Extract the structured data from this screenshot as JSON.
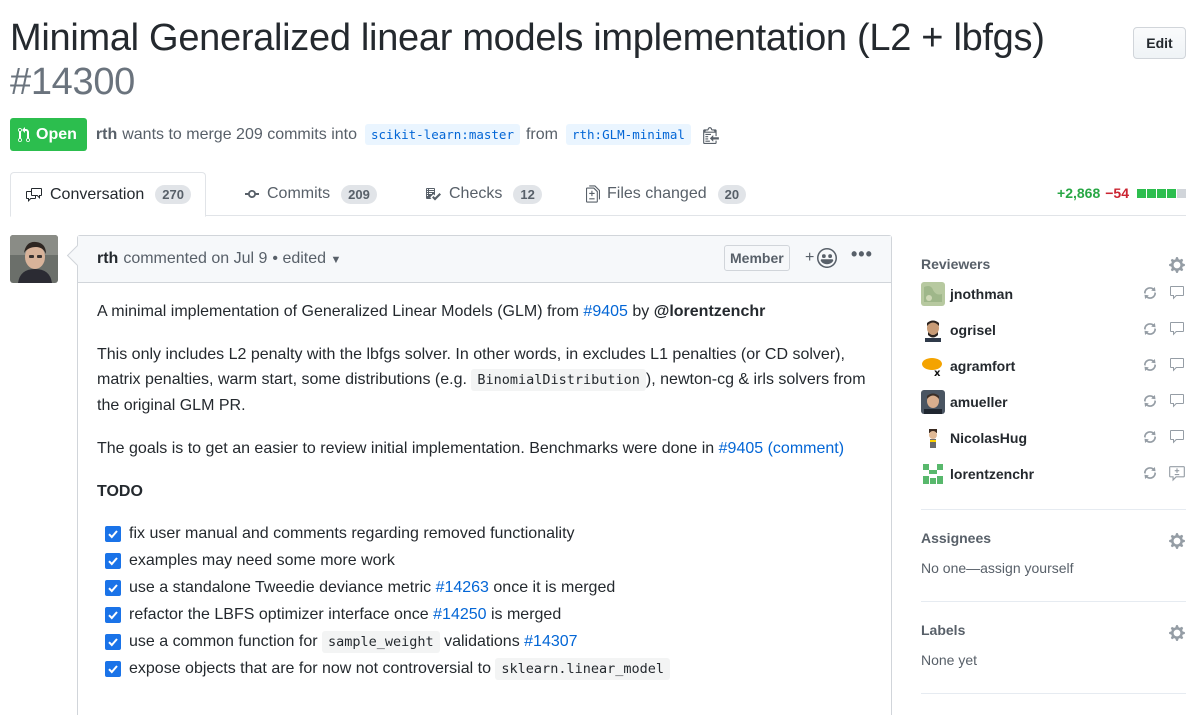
{
  "header": {
    "title": "Minimal Generalized linear models implementation (L2 + lbfgs)",
    "number": "#14300",
    "edit_label": "Edit"
  },
  "meta": {
    "state": "Open",
    "author": "rth",
    "merge_text": "wants to merge 209 commits into",
    "base_branch": "scikit-learn:master",
    "from_text": "from",
    "head_branch": "rth:GLM-minimal"
  },
  "tabs": [
    {
      "label": "Conversation",
      "count": "270",
      "icon": "comment-discussion-icon"
    },
    {
      "label": "Commits",
      "count": "209",
      "icon": "git-commit-icon"
    },
    {
      "label": "Checks",
      "count": "12",
      "icon": "checklist-icon"
    },
    {
      "label": "Files changed",
      "count": "20",
      "icon": "file-diff-icon"
    }
  ],
  "diffstat": {
    "additions": "+2,868",
    "deletions": "−54",
    "colors": [
      "#2cbe4e",
      "#2cbe4e",
      "#2cbe4e",
      "#2cbe4e",
      "#d1d5da"
    ]
  },
  "comment": {
    "author": "rth",
    "info": "commented on Jul 9",
    "edited": "• edited",
    "badge": "Member",
    "reaction": "+",
    "more": "•••",
    "p1": {
      "pre": "A minimal implementation of Generalized Linear Models (GLM) from ",
      "link": "#9405",
      "mid": " by ",
      "mention": "@lorentzenchr"
    },
    "p2": {
      "pre": "This only includes L2 penalty with the lbfgs solver. In other words, in excludes L1 penalties (or CD solver), matrix penalties, warm start, some distributions (e.g. ",
      "code": "BinomialDistribution",
      "post": "), newton-cg & irls solvers from the original GLM PR."
    },
    "p3": {
      "pre": "The goals is to get an easier to review initial implementation. Benchmarks were done in ",
      "link": "#9405 (comment)"
    },
    "todo_heading": "TODO",
    "tasks": [
      {
        "pre": "fix user manual and comments regarding removed functionality",
        "link": "",
        "code": "",
        "post": ""
      },
      {
        "pre": "examples may need some more work",
        "link": "",
        "code": "",
        "post": ""
      },
      {
        "pre": "use a standalone Tweedie deviance metric ",
        "link": "#14263",
        "code": "",
        "post": " once it is merged"
      },
      {
        "pre": "refactor the LBFS optimizer interface once ",
        "link": "#14250",
        "code": "",
        "post": " is merged"
      },
      {
        "pre": "use a common function for ",
        "code": "sample_weight",
        "post": " validations ",
        "link": "#14307"
      },
      {
        "pre": "expose objects that are for now not controversial to ",
        "code": "sklearn.linear_model",
        "post": "",
        "link": ""
      }
    ]
  },
  "sidebar": {
    "reviewers_heading": "Reviewers",
    "reviewers": [
      {
        "name": "jnothman"
      },
      {
        "name": "ogrisel"
      },
      {
        "name": "agramfort"
      },
      {
        "name": "amueller"
      },
      {
        "name": "NicolasHug"
      },
      {
        "name": "lorentzenchr"
      }
    ],
    "assignees_heading": "Assignees",
    "assignees_value": "No one—assign yourself",
    "labels_heading": "Labels",
    "labels_value": "None yet"
  }
}
